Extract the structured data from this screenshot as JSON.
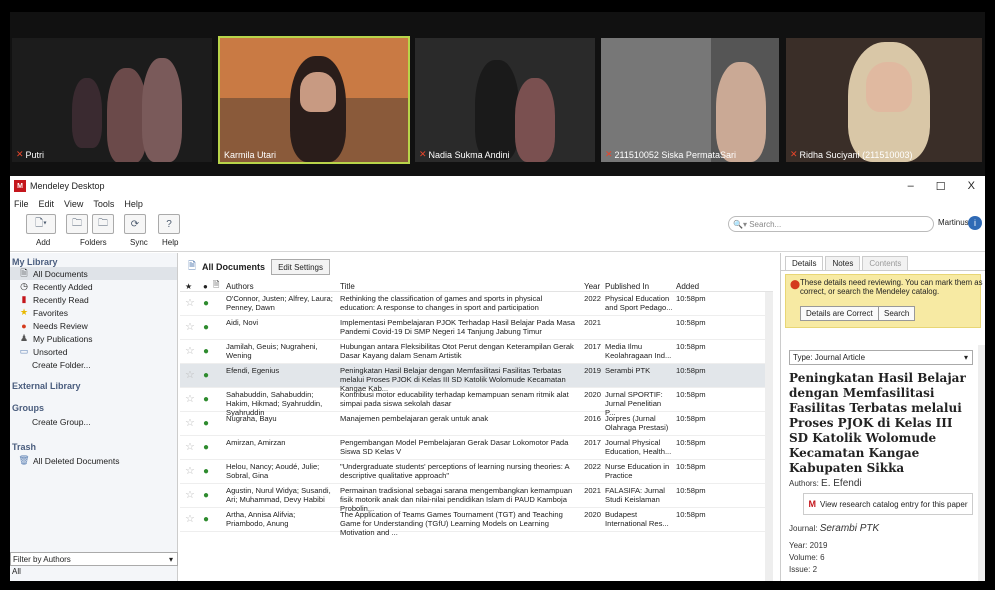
{
  "video": {
    "participants": [
      {
        "name": "Putri"
      },
      {
        "name": "Karmila Utari"
      },
      {
        "name": "Nadia Sukma Andini"
      },
      {
        "name": "211510052 Siska PermataSari"
      },
      {
        "name": "Ridha Suciyani (211510003)"
      }
    ]
  },
  "window": {
    "title": "Mendeley Desktop",
    "minimize": "–",
    "maximize": "☐",
    "close": "X"
  },
  "menu": [
    "File",
    "Edit",
    "View",
    "Tools",
    "Help"
  ],
  "toolbar": {
    "add": "Add",
    "folders": "Folders",
    "sync": "Sync",
    "help": "Help",
    "search_placeholder": "Search...",
    "user": "Martinus"
  },
  "sidebar": {
    "my_library": "My Library",
    "items": [
      {
        "label": "All Documents",
        "icon": "document-icon"
      },
      {
        "label": "Recently Added",
        "icon": "clock-icon"
      },
      {
        "label": "Recently Read",
        "icon": "book-icon"
      },
      {
        "label": "Favorites",
        "icon": "star-icon"
      },
      {
        "label": "Needs Review",
        "icon": "alert-icon"
      },
      {
        "label": "My Publications",
        "icon": "person-icon"
      },
      {
        "label": "Unsorted",
        "icon": "tray-icon"
      },
      {
        "label": "Create Folder...",
        "icon": ""
      }
    ],
    "external_library": "External Library",
    "groups": "Groups",
    "create_group": "Create Group...",
    "trash": "Trash",
    "all_deleted": "All Deleted Documents",
    "filter": "Filter by Authors",
    "filter_value": "All"
  },
  "center": {
    "heading": "All Documents",
    "edit_settings": "Edit Settings",
    "columns": {
      "authors": "Authors",
      "title": "Title",
      "year": "Year",
      "published_in": "Published In",
      "added": "Added"
    },
    "rows": [
      {
        "authors": "O'Connor, Justen; Alfrey, Laura; Penney, Dawn",
        "title": "Rethinking the classification of games and sports in physical education: A response to changes in sport and participation",
        "year": "2022",
        "pub": "Physical Education and Sport Pedago...",
        "added": "10:58pm"
      },
      {
        "authors": "Aidi, Novi",
        "title": "Implementasi Pembelajaran PJOK Terhadap Hasil Belajar Pada Masa Pandemi Covid-19 Di SMP Negeri 14 Tanjung Jabung Timur",
        "year": "2021",
        "pub": "",
        "added": "10:58pm"
      },
      {
        "authors": "Jamilah, Geuis; Nugraheni, Wening",
        "title": "Hubungan antara Fleksibilitas Otot Perut dengan Keterampilan Gerak Dasar Kayang dalam Senam Artistik",
        "year": "2017",
        "pub": "Media Ilmu Keolahragaan Ind...",
        "added": "10:58pm"
      },
      {
        "authors": "Efendi, Egenius",
        "title": "Peningkatan Hasil Belajar dengan Memfasilitasi Fasilitas Terbatas melalui Proses PJOK di Kelas III SD Katolik Wolomude Kecamatan Kangae Kab...",
        "year": "2019",
        "pub": "Serambi PTK",
        "added": "10:58pm"
      },
      {
        "authors": "Sahabuddin, Sahabuddin; Hakim, Hikmad; Syahruddin, Syahruddin",
        "title": "Kontribusi motor educability terhadap kemampuan senam ritmik alat simpai pada siswa sekolah dasar",
        "year": "2020",
        "pub": "Jurnal SPORTIF: Jurnal Penelitian P...",
        "added": "10:58pm"
      },
      {
        "authors": "Nugraha, Bayu",
        "title": "Manajemen pembelajaran gerak untuk anak",
        "year": "2016",
        "pub": "Jorpres (Jurnal Olahraga Prestasi)",
        "added": "10:58pm"
      },
      {
        "authors": "Amirzan, Amirzan",
        "title": "Pengembangan Model Pembelajaran Gerak Dasar Lokomotor Pada Siswa SD Kelas V",
        "year": "2017",
        "pub": "Journal Physical Education, Health...",
        "added": "10:58pm"
      },
      {
        "authors": "Helou, Nancy; Aoudé, Julie; Sobral, Gina",
        "title": "\"Undergraduate students' perceptions of learning nursing theories: A descriptive qualitative approach\"",
        "year": "2022",
        "pub": "Nurse Education in Practice",
        "added": "10:58pm"
      },
      {
        "authors": "Agustin, Nurul Widya; Susandi, Ari; Muhammad, Devy Habibi",
        "title": "Permainan tradisional sebagai sarana mengembangkan kemampuan fisik motorik anak dan nilai-nilai pendidikan Islam di PAUD Kamboja Probolin...",
        "year": "2021",
        "pub": "FALASIFA: Jurnal Studi Keislaman",
        "added": "10:58pm"
      },
      {
        "authors": "Artha, Annisa Alifvia; Priambodo, Anung",
        "title": "The Application of Teams Games Tournament (TGT) and Teaching Game for Understanding (TGfU) Learning Models on Learning Motivation and ...",
        "year": "2020",
        "pub": "Budapest International Res...",
        "added": "10:58pm"
      }
    ]
  },
  "details": {
    "tabs": [
      "Details",
      "Notes",
      "Contents"
    ],
    "notice": "These details need reviewing. You can mark them as correct, or search the Mendeley catalog.",
    "correct_button": "Details are Correct",
    "search_button": "Search",
    "type": "Type: Journal Article",
    "title": "Peningkatan Hasil Belajar dengan Memfasilitasi Fasilitas Terbatas melalui Proses PJOK di Kelas III SD Katolik Wolomude Kecamatan Kangae Kabupaten Sikka",
    "authors_label": "Authors:",
    "authors_value": "E. Efendi",
    "catalog_link": "View research catalog entry for this paper",
    "journal_label": "Journal:",
    "journal_value": "Serambi PTK",
    "year_label": "Year:",
    "year_value": "2019",
    "volume_label": "Volume:",
    "volume_value": "6",
    "issue_label": "Issue:",
    "issue_value": "2"
  }
}
